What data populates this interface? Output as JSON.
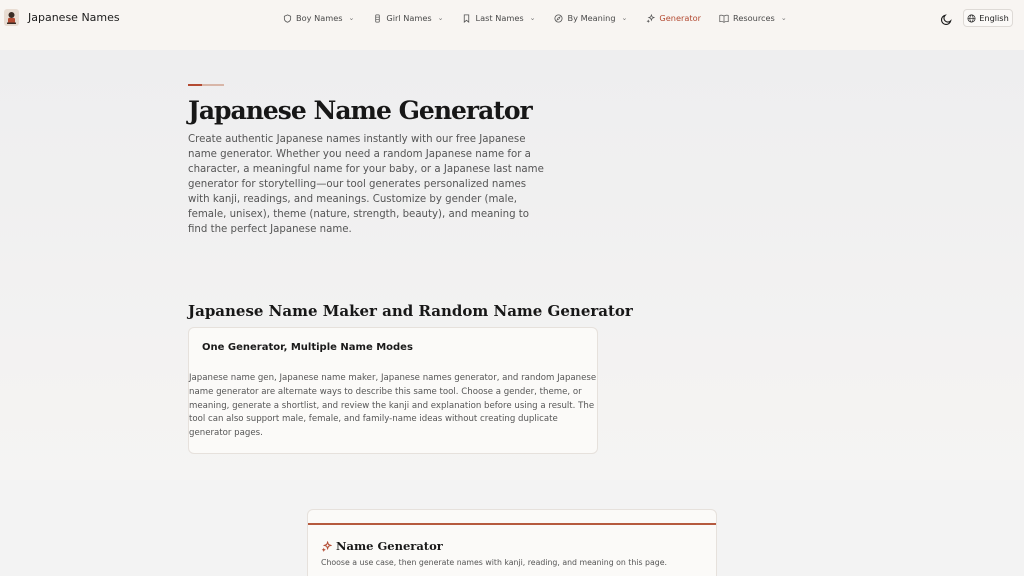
{
  "header": {
    "brand": "Japanese Names",
    "nav": [
      {
        "label": "Boy Names",
        "icon": "shield-icon",
        "has_dropdown": true,
        "active": false
      },
      {
        "label": "Girl Names",
        "icon": "scroll-icon",
        "has_dropdown": true,
        "active": false
      },
      {
        "label": "Last Names",
        "icon": "bookmark-icon",
        "has_dropdown": true,
        "active": false
      },
      {
        "label": "By Meaning",
        "icon": "compass-icon",
        "has_dropdown": true,
        "active": false
      },
      {
        "label": "Generator",
        "icon": "sparkles-icon",
        "has_dropdown": false,
        "active": true
      },
      {
        "label": "Resources",
        "icon": "book-icon",
        "has_dropdown": true,
        "active": false
      }
    ],
    "language": "English"
  },
  "hero": {
    "title": "Japanese Name Generator",
    "intro": "Create authentic Japanese names instantly with our free Japanese name generator. Whether you need a random Japanese name for a character, a meaningful name for your baby, or a Japanese last name generator for storytelling—our tool generates personalized names with kanji, readings, and meanings. Customize by gender (male, female, unisex), theme (nature, strength, beauty), and meaning to find the perfect Japanese name."
  },
  "maker_section": {
    "title": "Japanese Name Maker and Random Name Generator",
    "card_title": "One Generator, Multiple Name Modes",
    "card_text": "Japanese name gen, Japanese name maker, Japanese names generator, and random Japanese name generator are alternate ways to describe this same tool. Choose a gender, theme, or meaning, generate a shortlist, and review the kanji and explanation before using a result. The tool can also support male, female, and family-name ideas without creating duplicate generator pages."
  },
  "generator_card": {
    "title": "Name Generator",
    "subtitle": "Choose a use case, then generate names with kanji, reading, and meaning on this page."
  },
  "colors": {
    "accent": "#b34a32",
    "header_bg": "#f8f5f2",
    "page_bg": "#f1f0ef"
  }
}
